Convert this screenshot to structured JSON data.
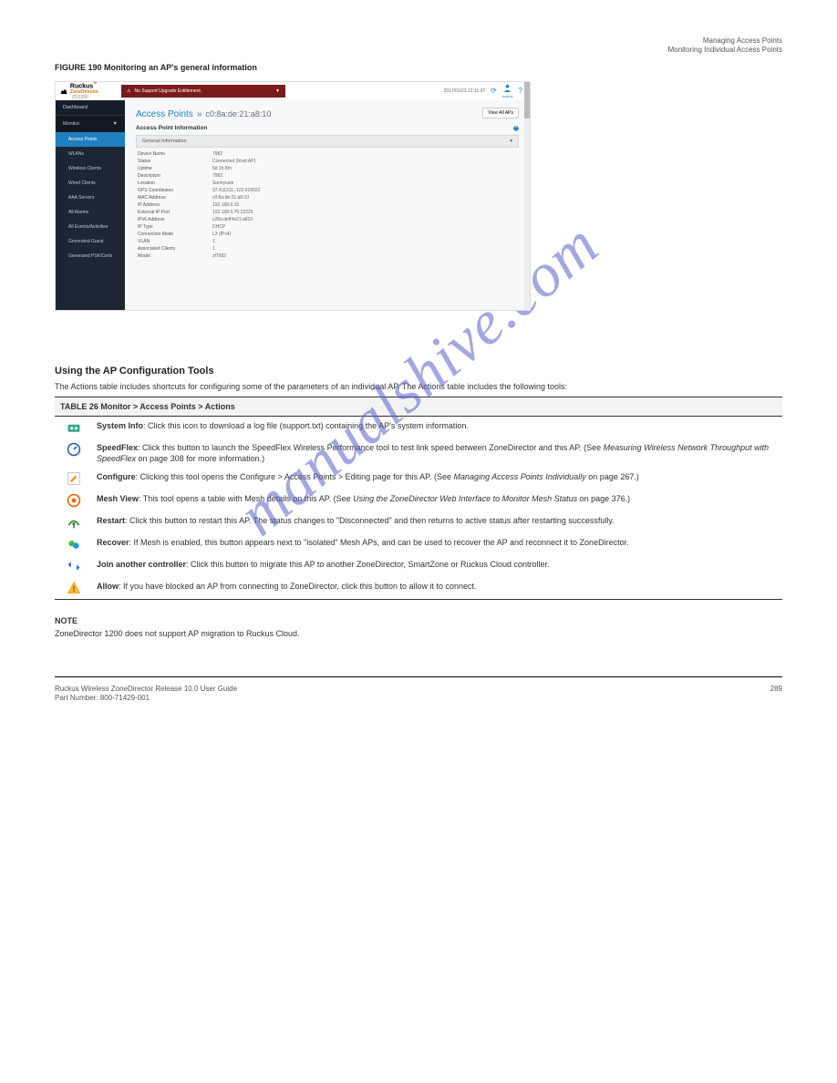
{
  "watermark": "manualshive.com",
  "breadcrumb": "Managing Access Points\nMonitoring Individual Access Points",
  "figure_label": "FIGURE 190",
  "figure_title": "Monitoring an AP's general information",
  "shot": {
    "logo_brand": "Ruckus",
    "logo_sub": "ZoneDirector",
    "logo_zd": "ZD1200",
    "banner_text": "No Support Upgrade Entitlement.",
    "timestamp": "2017/01/23 12:11:37",
    "user": "ruckus",
    "side_dashboard": "Dashboard",
    "side_monitor": "Monitor",
    "side_items": [
      "Access Points",
      "WLANs",
      "Wireless Clients",
      "Wired Clients",
      "AAA Servers",
      "All Alarms",
      "All Events/Activities",
      "Generated Guest",
      "Generated PSK/Certs"
    ],
    "title_main": "Access Points",
    "title_sep": "»",
    "title_mac": "c0:8a:de:21:a8:10",
    "view_all": "View All APs",
    "ap_info_label": "Access Point Information",
    "gi_label": "General Information",
    "rows": [
      {
        "k": "Device Name",
        "v": "7982"
      },
      {
        "k": "Status",
        "v": "Connected (Root AP)"
      },
      {
        "k": "Uptime",
        "v": "6d 1h 8m"
      },
      {
        "k": "Description",
        "v": "7982"
      },
      {
        "k": "Location",
        "v": "Sunnyvale"
      },
      {
        "k": "GPS Coordinates",
        "v": "37.411311,-122.019922"
      },
      {
        "k": "MAC Address",
        "v": "c0:8a:de:21:a8:10"
      },
      {
        "k": "IP Address",
        "v": "192.168.0.15"
      },
      {
        "k": "External IP:Port",
        "v": "192.168.0.76:12225"
      },
      {
        "k": "IPv6 Address",
        "v": "c28a:deff:fe21:a810"
      },
      {
        "k": "IP Type",
        "v": "DHCP"
      },
      {
        "k": "Connection Mode",
        "v": "L3 (IPv4)"
      },
      {
        "k": "VLAN",
        "v": "1"
      },
      {
        "k": "Associated Clients",
        "v": "1"
      },
      {
        "k": "Model",
        "v": "zf7982"
      }
    ]
  },
  "actions_h2": "Using the AP Configuration Tools",
  "actions_intro": "The Actions table includes shortcuts for configuring some of the parameters of an individual AP. The Actions table includes the following tools:",
  "tbl_header": "TABLE 26 Monitor > Access Points > Actions",
  "rows": [
    {
      "icon": "group",
      "html": "<b>System Info</b>: Click this icon to download a log file (support.txt) containing the AP's system information."
    },
    {
      "icon": "speed",
      "html": "<b>SpeedFlex</b>: Click this button to launch the SpeedFlex Wireless Performance tool to test link speed between ZoneDirector and this AP. (See <i>Measuring Wireless Network Throughput with SpeedFlex</i> on page 308 for more information.)"
    },
    {
      "icon": "edit",
      "html": "<b>Configure</b>: Clicking this tool opens the Configure > Access Points > Editing page for this AP. (See <i>Managing Access Points Individually</i> on page 267.)"
    },
    {
      "icon": "mesh",
      "html": "<b>Mesh View</b>: This tool opens a table with Mesh details on this AP. (See <i>Using the ZoneDirector Web Interface to Monitor Mesh Status</i> on page 376.)"
    },
    {
      "icon": "radio",
      "html": "<b>Restart</b>: Click this button to restart this AP. The status changes to \"Disconnected\" and then returns to active status after restarting successfully."
    },
    {
      "icon": "recover",
      "html": "<b>Recover</b>: If Mesh is enabled, this button appears next to \"isolated\" Mesh APs, and can be used to recover the AP and reconnect it to ZoneDirector."
    },
    {
      "icon": "join",
      "html": "<b>Join another controller</b>: Click this button to migrate this AP to another ZoneDirector, SmartZone or Ruckus Cloud controller."
    },
    {
      "icon": "warn",
      "html": "<b>Allow</b>: If you have blocked an AP from connecting to ZoneDirector, click this button to allow it to connect."
    }
  ],
  "note_label": "NOTE",
  "note_body": "ZoneDirector 1200 does not support AP migration to Ruckus Cloud.",
  "footer_left_line1": "Ruckus Wireless ZoneDirector Release 10.0 User Guide",
  "footer_left_line2": "Part Number: 800-71429-001",
  "page_no": "289"
}
